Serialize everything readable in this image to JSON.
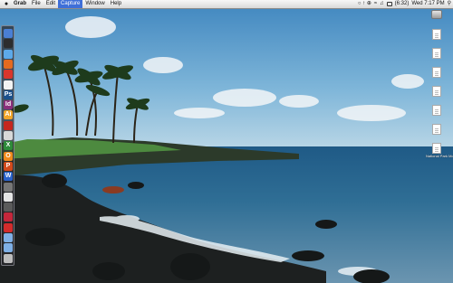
{
  "menubar": {
    "apple_icon": "apple-icon",
    "app_name": "Grab",
    "menus": [
      "File",
      "Edit",
      "Capture",
      "Window",
      "Help"
    ],
    "selected_menu": "Capture",
    "status_battery": "(6:32)",
    "clock": "Wed 7:17 PM",
    "status_icons": [
      "wifi-icon",
      "volume-icon",
      "battery-icon",
      "spotlight-icon"
    ]
  },
  "dock": {
    "items": [
      {
        "name": "finder-icon",
        "glyph": "",
        "color": "#4a7fd4"
      },
      {
        "name": "dashboard-icon",
        "glyph": "",
        "color": "#2d2d2d"
      },
      {
        "name": "safari-icon",
        "glyph": "",
        "color": "#5da9e9"
      },
      {
        "name": "firefox-icon",
        "glyph": "",
        "color": "#e56a1f"
      },
      {
        "name": "chrome-icon",
        "glyph": "",
        "color": "#d9362c"
      },
      {
        "name": "ical-icon",
        "glyph": "",
        "color": "#f3f3f3"
      },
      {
        "name": "photoshop-icon",
        "glyph": "Ps",
        "color": "#1a4f8c"
      },
      {
        "name": "indesign-icon",
        "glyph": "Id",
        "color": "#8a2e7b"
      },
      {
        "name": "illustrator-icon",
        "glyph": "Ai",
        "color": "#f1a52a"
      },
      {
        "name": "acrobat-icon",
        "glyph": "",
        "color": "#c5271f"
      },
      {
        "name": "app-icon-1",
        "glyph": "",
        "color": "#d8d8d8"
      },
      {
        "name": "excel-icon",
        "glyph": "X",
        "color": "#2e8b3a"
      },
      {
        "name": "outlook-icon",
        "glyph": "O",
        "color": "#f08a1c"
      },
      {
        "name": "powerpoint-icon",
        "glyph": "P",
        "color": "#d24a1c"
      },
      {
        "name": "word-icon",
        "glyph": "W",
        "color": "#2a62c9"
      },
      {
        "name": "app-icon-2",
        "glyph": "",
        "color": "#777777"
      },
      {
        "name": "app-icon-3",
        "glyph": "",
        "color": "#e4e4e4"
      },
      {
        "name": "app-icon-4",
        "glyph": "",
        "color": "#5b5b5b"
      },
      {
        "name": "app-icon-5",
        "glyph": "",
        "color": "#c4273b"
      },
      {
        "name": "app-icon-6",
        "glyph": "",
        "color": "#d22c2c"
      },
      {
        "name": "folder-icon-1",
        "glyph": "",
        "color": "#7fb0e6"
      },
      {
        "name": "folder-icon-2",
        "glyph": "",
        "color": "#7fb0e6"
      },
      {
        "name": "trash-icon",
        "glyph": "",
        "color": "#bdbdbd"
      }
    ]
  },
  "desktop_files": [
    {
      "label": "",
      "type": "drive"
    },
    {
      "label": "",
      "type": "doc"
    },
    {
      "label": "",
      "type": "doc"
    },
    {
      "label": "",
      "type": "doc"
    },
    {
      "label": "",
      "type": "doc"
    },
    {
      "label": "",
      "type": "doc"
    },
    {
      "label": "",
      "type": "doc"
    },
    {
      "label": "National Park Mouse...docx",
      "type": "doc"
    }
  ]
}
